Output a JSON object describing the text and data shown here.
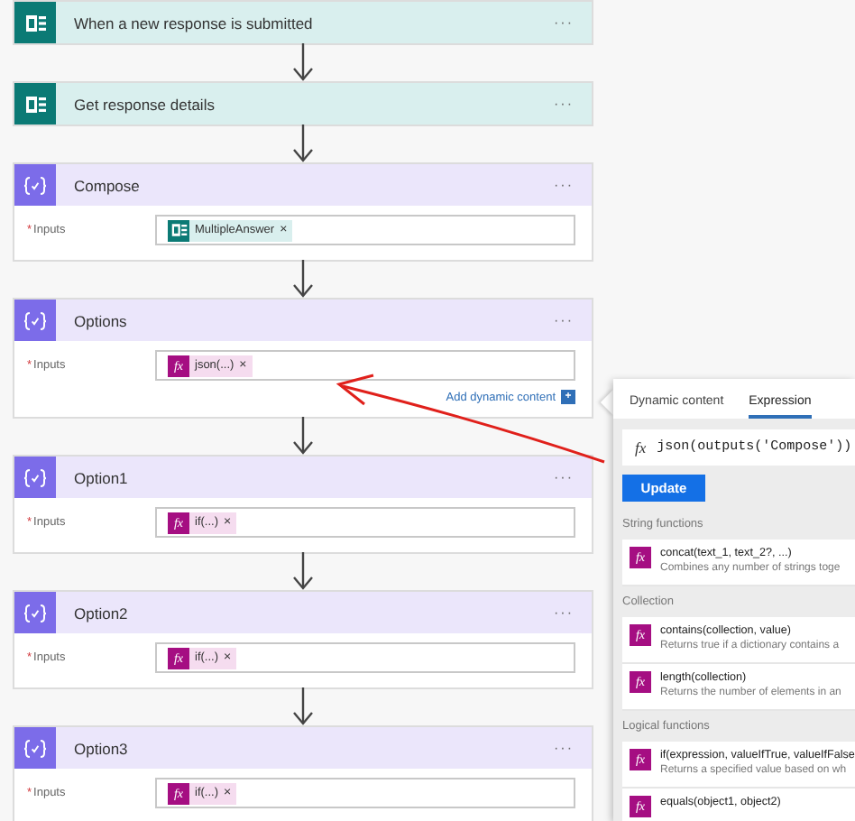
{
  "flow": {
    "steps": [
      {
        "kind": "forms",
        "title": "When a new response is submitted",
        "menu": "···"
      },
      {
        "kind": "forms",
        "title": "Get response details",
        "menu": "···"
      },
      {
        "kind": "compose",
        "title": "Compose",
        "menu": "···",
        "inputs": {
          "required_mark": "*",
          "label": "Inputs",
          "token": {
            "kind": "forms",
            "label": "MultipleAnswer",
            "remove": "×"
          }
        }
      },
      {
        "kind": "compose",
        "title": "Options",
        "menu": "···",
        "inputs": {
          "required_mark": "*",
          "label": "Inputs",
          "token": {
            "kind": "expression",
            "icon_text": "fx",
            "label": "json(...)",
            "remove": "×"
          },
          "link": "Add dynamic content",
          "link_icon": "+"
        }
      },
      {
        "kind": "compose",
        "title": "Option1",
        "menu": "···",
        "inputs": {
          "required_mark": "*",
          "label": "Inputs",
          "token": {
            "kind": "expression",
            "icon_text": "fx",
            "label": "if(...)",
            "remove": "×"
          }
        }
      },
      {
        "kind": "compose",
        "title": "Option2",
        "menu": "···",
        "inputs": {
          "required_mark": "*",
          "label": "Inputs",
          "token": {
            "kind": "expression",
            "icon_text": "fx",
            "label": "if(...)",
            "remove": "×"
          }
        }
      },
      {
        "kind": "compose",
        "title": "Option3",
        "menu": "···",
        "inputs": {
          "required_mark": "*",
          "label": "Inputs",
          "token": {
            "kind": "expression",
            "icon_text": "fx",
            "label": "if(...)",
            "remove": "×"
          }
        }
      }
    ]
  },
  "panel": {
    "tabs": [
      {
        "label": "Dynamic content",
        "selected": false
      },
      {
        "label": "Expression",
        "selected": true
      }
    ],
    "expression": {
      "icon_text": "fx",
      "value": "json(outputs('Compose'))"
    },
    "button": "Update",
    "sections": [
      {
        "title": "String functions",
        "items": [
          {
            "icon_text": "fx",
            "name": "concat(text_1, text_2?, ...)",
            "description": "Combines any number of strings toge"
          }
        ]
      },
      {
        "title": "Collection",
        "items": [
          {
            "icon_text": "fx",
            "name": "contains(collection, value)",
            "description": "Returns true if a dictionary contains a"
          },
          {
            "icon_text": "fx",
            "name": "length(collection)",
            "description": "Returns the number of elements in an"
          }
        ]
      },
      {
        "title": "Logical functions",
        "items": [
          {
            "icon_text": "fx",
            "name": "if(expression, valueIfTrue, valueIfFalse",
            "description": "Returns a specified value based on wh"
          },
          {
            "icon_text": "fx",
            "name": "equals(object1, object2)"
          }
        ]
      }
    ]
  }
}
